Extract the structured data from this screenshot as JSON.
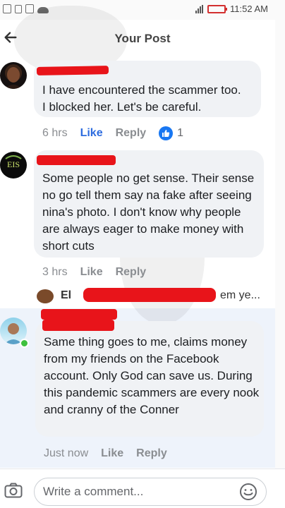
{
  "status_bar": {
    "time": "11:52 AM"
  },
  "header": {
    "title": "Your Post"
  },
  "comments": [
    {
      "text": "I have encountered the scammer too.\nI blocked her. Let's be careful.",
      "time": "6 hrs",
      "like_label": "Like",
      "reply_label": "Reply",
      "reaction_count": "1"
    },
    {
      "text": "Some people no get sense. Their sense no go tell them say na fake after seeing nina's photo. I don't know why people are always eager to make money with short cuts",
      "time": "3 hrs",
      "like_label": "Like",
      "reply_label": "Reply",
      "reply_preview": {
        "name_visible": "El",
        "tail_visible": "em ye..."
      }
    },
    {
      "text": "Same thing goes to me, claims money from my friends on the Facebook account. Only God can save us. During this pandemic scammers are every nook and cranny of the Conner",
      "time": "Just now",
      "like_label": "Like",
      "reply_label": "Reply"
    }
  ],
  "composer": {
    "placeholder": "Write a comment..."
  },
  "icons": {
    "back": "arrow-left-icon",
    "camera": "camera-icon",
    "emoji": "emoji-icon",
    "like_reaction": "thumbs-up-icon"
  },
  "colors": {
    "accent": "#1877f2",
    "like_blue": "#2d6cdf",
    "redaction": "#e8141a",
    "online": "#3ec13e"
  }
}
